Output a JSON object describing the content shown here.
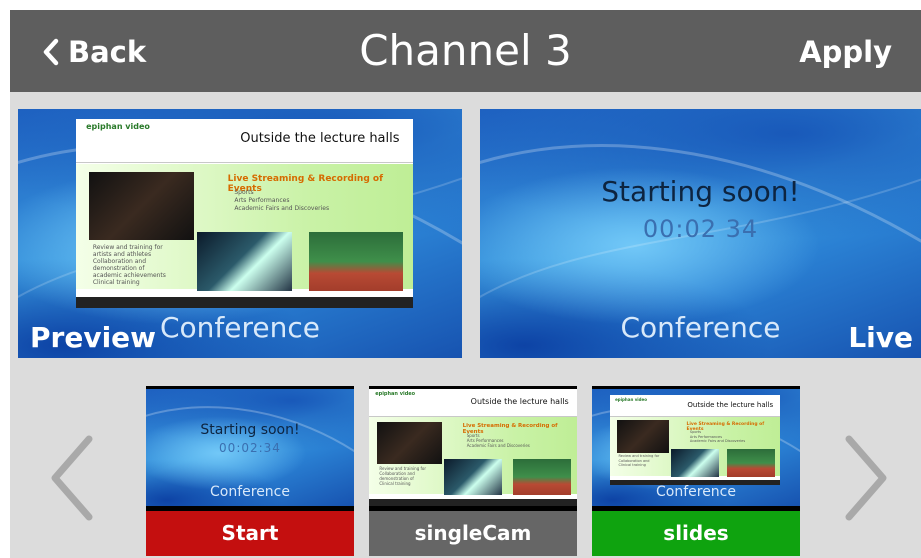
{
  "header": {
    "back_label": "Back",
    "title": "Channel 3",
    "apply_label": "Apply"
  },
  "preview": {
    "tag": "Preview",
    "background_label": "Conference",
    "slide": {
      "logo": "epiphan video",
      "title": "Outside the lecture halls",
      "section_title": "Live Streaming & Recording of Events",
      "bullets_top": [
        "Sports",
        "Arts Performances",
        "Academic Fairs and Discoveries"
      ],
      "bullets_left": [
        "Review and training for",
        "artists and athletes",
        "Collaboration and",
        "demonstration of",
        "academic achievements",
        "Clinical training"
      ]
    }
  },
  "live": {
    "tag": "Live",
    "message": "Starting soon!",
    "timer": "00:02 34",
    "background_label": "Conference"
  },
  "thumbnails": [
    {
      "label": "Start",
      "message": "Starting soon!",
      "timer": "00:02:34",
      "background_label": "Conference"
    },
    {
      "label": "singleCam"
    },
    {
      "label": "slides",
      "background_label": "Conference"
    }
  ],
  "colors": {
    "header_bg": "#5e5e5e",
    "start": "#c40f0f",
    "singlecam": "#666666",
    "slides": "#0fa30f"
  },
  "icons": {
    "back": "chevron-left-icon",
    "prev": "chevron-left-icon",
    "next": "chevron-right-icon"
  }
}
